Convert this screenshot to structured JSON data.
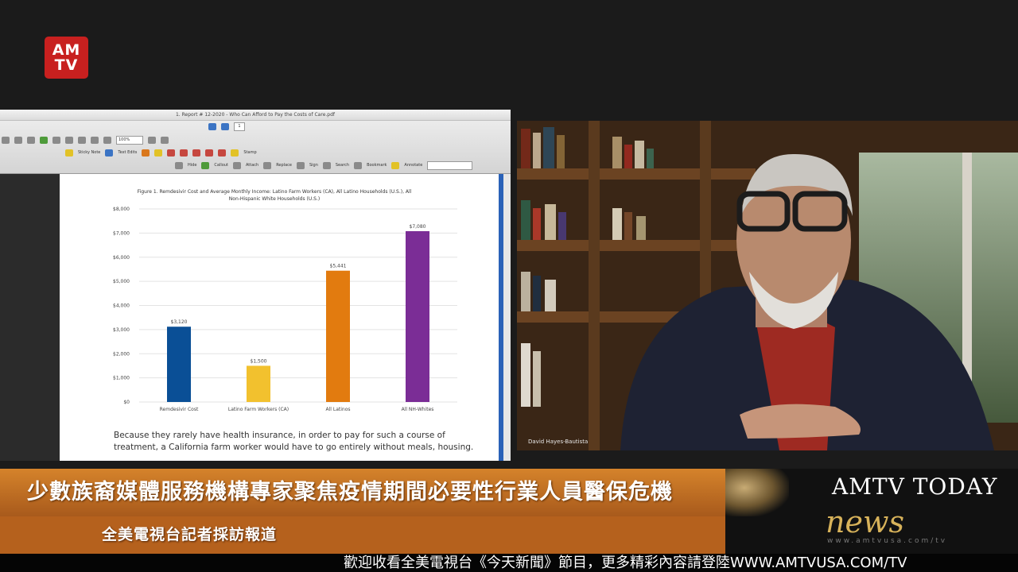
{
  "logo": {
    "line1": "AM",
    "line2": "TV"
  },
  "pdf_viewer": {
    "window_title": "1. Report # 12-2020 - Who Can Afford to Pay the Costs of Care.pdf",
    "page_number": "1",
    "zoom": "100%",
    "toolbar_row2": [
      "Sticky Note",
      "Text Edits",
      "Stamp"
    ],
    "toolbar_row3": [
      "Hide",
      "Callout",
      "Attach",
      "Replace",
      "Sign",
      "Search",
      "Bookmark",
      "Annotate"
    ]
  },
  "chart_data": {
    "type": "bar",
    "title": "Figure 1. Remdesivir Cost and Average Monthly Income: Latino Farm Workers (CA), All Latino Households (U.S.), All Non-Hispanic White Households (U.S.)",
    "categories": [
      "Remdesivir Cost",
      "Latino Farm Workers (CA)",
      "All Latinos",
      "All NH-Whites"
    ],
    "values": [
      3120,
      1500,
      5441,
      7080
    ],
    "value_labels": [
      "$3,120",
      "$1,500",
      "$5,441",
      "$7,080"
    ],
    "colors": [
      "#0a4f96",
      "#f2c12e",
      "#e27b0f",
      "#7b2d96"
    ],
    "ylim": [
      0,
      8000
    ],
    "yticks": [
      "$0",
      "$1,000",
      "$2,000",
      "$3,000",
      "$4,000",
      "$5,000",
      "$6,000",
      "$7,000",
      "$8,000"
    ],
    "grid": true
  },
  "document": {
    "caption": "Because they rarely have health insurance, in order to pay for such a course of treatment, a California farm worker would have to go entirely without meals, housing."
  },
  "video": {
    "participant_name": "David Hayes-Bautista"
  },
  "lower_third": {
    "headline": "少數族裔媒體服務機構專家聚焦疫情期間必要性行業人員醫保危機",
    "subline": "全美電視台記者採訪報道"
  },
  "brand": {
    "title": "AMTV TODAY",
    "news": "news",
    "url": "www.amtvusa.com/tv"
  },
  "ticker": {
    "text": "歡迎收看全美電視台《今天新聞》節目，更多精彩內容請登陸WWW.AMTVUSA.COM/TV"
  }
}
